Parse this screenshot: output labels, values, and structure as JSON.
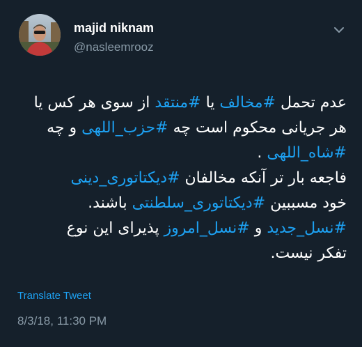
{
  "user": {
    "display_name": "majid niknam",
    "handle": "@nasleemrooz"
  },
  "tweet": {
    "line1": {
      "t1": "عدم تحمل ",
      "tag1": "#مخالف",
      "t2": " یا ",
      "tag2": "#منتقد",
      "t3": " از سوی هر کس یا"
    },
    "line2": {
      "t1": "هر جریانی محکوم است چه ",
      "tag1": "#حزب_اللهی",
      "t2": " و چه"
    },
    "line3": {
      "tag1": "#شاه_اللهی",
      "t1": " ."
    },
    "line4": {
      "t1": "فاجعه بار تر آنکه مخالفان ",
      "tag1": "#دیکتاتوری_دینی"
    },
    "line5": {
      "t1": "خود مسببین ",
      "tag1": "#دیکتاتوری_سلطنتی",
      "t2": " باشند."
    },
    "line6": {
      "tag1": "#نسل_جدید",
      "t1": " و ",
      "tag2": "#نسل_امروز",
      "t2": " پذیرای این نوع"
    },
    "line7": {
      "t1": "تفکر نیست."
    }
  },
  "translate_label": "Translate Tweet",
  "timestamp": "8/3/18, 11:30 PM",
  "icons": {
    "caret": "chevron-down-icon"
  },
  "colors": {
    "background": "#15202b",
    "link": "#1da1f2",
    "secondary": "#8899a6"
  }
}
